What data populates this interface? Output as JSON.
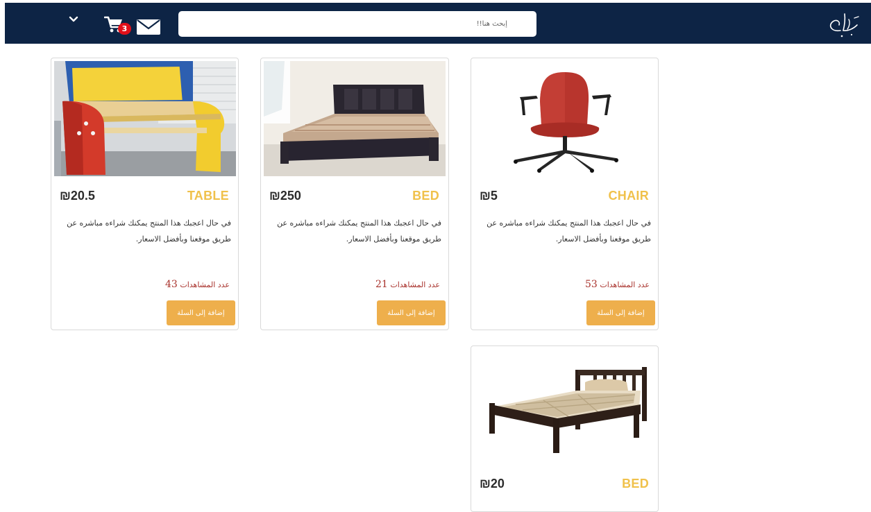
{
  "header": {
    "search_placeholder": "إبحث هنا!!",
    "cart_count": "3",
    "icons": [
      "chevron-down-icon",
      "shopping-cart-icon",
      "mail-icon",
      "calligraphy-logo"
    ],
    "background_color": "#0d2445",
    "badge_color": "#e0101a"
  },
  "products": [
    {
      "name": "CHAIR",
      "price": "₪5",
      "description": "في حال اعجبك هذا المنتج يمكنك شراءه مباشره عن طريق موقعنا وبأفضل الاسعار.",
      "views_label": "عدد المشاهدات",
      "views_count": "53",
      "button_label": "إضافة إلى السلة"
    },
    {
      "name": "BED",
      "price": "₪250",
      "description": "في حال اعجبك هذا المنتج يمكنك شراءه مباشره عن طريق موقعنا وبأفضل الاسعار.",
      "views_label": "عدد المشاهدات",
      "views_count": "21",
      "button_label": "إضافة إلى السلة"
    },
    {
      "name": "TABLE",
      "price": "₪20.5",
      "description": "في حال اعجبك هذا المنتج يمكنك شراءه مباشره عن طريق موقعنا وبأفضل الاسعار.",
      "views_label": "عدد المشاهدات",
      "views_count": "43",
      "button_label": "إضافة إلى السلة"
    },
    {
      "name": "BED",
      "price": "₪20"
    }
  ],
  "colors": {
    "product_name": "#f0c14b",
    "views_text": "#a8312b",
    "add_to_cart_button": "#eeaf4c"
  }
}
